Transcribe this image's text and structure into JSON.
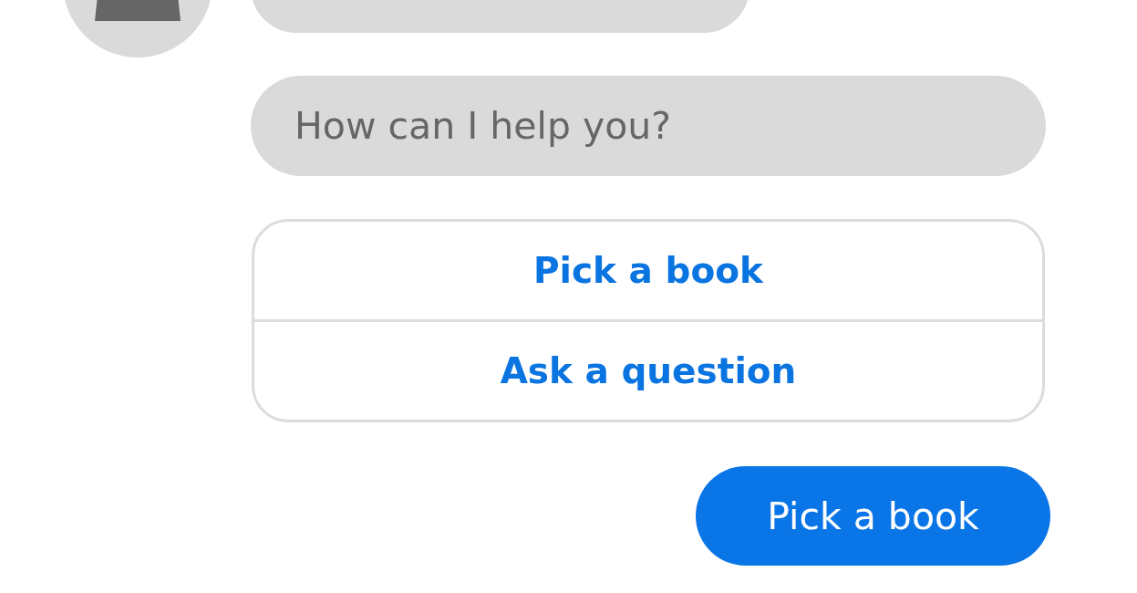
{
  "messages": [
    {
      "kind": "bot_text",
      "avatar": true
    },
    {
      "kind": "bot_text",
      "avatar": false,
      "text": "How can I help you?"
    },
    {
      "kind": "choices",
      "options": [
        {
          "label": "Pick a book"
        },
        {
          "label": "Ask a question"
        }
      ]
    },
    {
      "kind": "user_text",
      "text": "Pick a book"
    }
  ]
}
